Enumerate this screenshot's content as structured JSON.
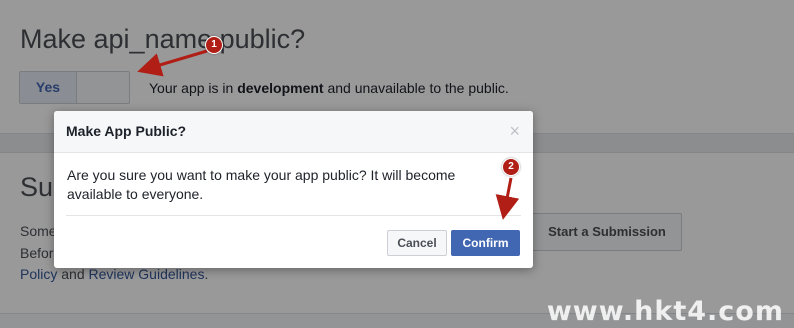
{
  "publish": {
    "title": "Make api_name public?",
    "toggle_yes": "Yes",
    "status_prefix": "Your app is in ",
    "status_bold": "development",
    "status_suffix": " and unavailable to the public."
  },
  "submission": {
    "title_partial": "Sub",
    "line1_partial": "Some",
    "line2_partial": "Befor",
    "line3_link1": "Policy",
    "line3_and": " and ",
    "line3_link2": "Review Guidelines",
    "line3_end": ".",
    "start_button": "Start a Submission"
  },
  "dialog": {
    "title": "Make App Public?",
    "close_glyph": "×",
    "message": "Are you sure you want to make your app public? It will become available to everyone.",
    "cancel_label": "Cancel",
    "confirm_label": "Confirm"
  },
  "annotations": {
    "badge1": "1",
    "badge2": "2",
    "color": "#b01e16"
  },
  "watermark": "www.hkt4.com",
  "colors": {
    "primary": "#4267b2",
    "link": "#365899",
    "overlay": "rgba(0,0,0,0.4)"
  }
}
